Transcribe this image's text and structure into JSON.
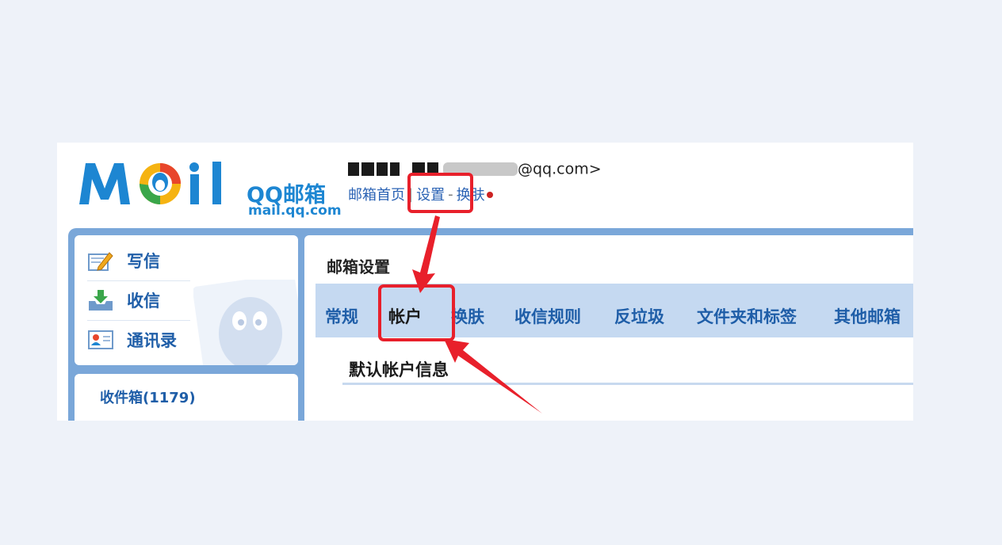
{
  "header": {
    "brand_zh": "QQ邮箱",
    "brand_url": "mail.qq.com",
    "email_suffix": "@qq.com>",
    "links": [
      "邮箱首页",
      "设置",
      "换肤"
    ],
    "separators": [
      "|",
      "-"
    ]
  },
  "sidebar": {
    "compose": "写信",
    "receive": "收信",
    "contacts": "通讯录",
    "inbox": "收件箱(1179)"
  },
  "main": {
    "title": "邮箱设置",
    "tabs": [
      "常规",
      "帐户",
      "换肤",
      "收信规则",
      "反垃圾",
      "文件夹和标签",
      "其他邮箱"
    ],
    "active_tab": "帐户",
    "section_title": "默认帐户信息"
  },
  "colors": {
    "brand_blue": "#1d86d2",
    "link_blue": "#2a62b4",
    "frame_blue": "#7aa7d9",
    "tab_bar": "#c5d9f1",
    "annotation_red": "#e8202b",
    "page_bg": "#eef2f9"
  }
}
